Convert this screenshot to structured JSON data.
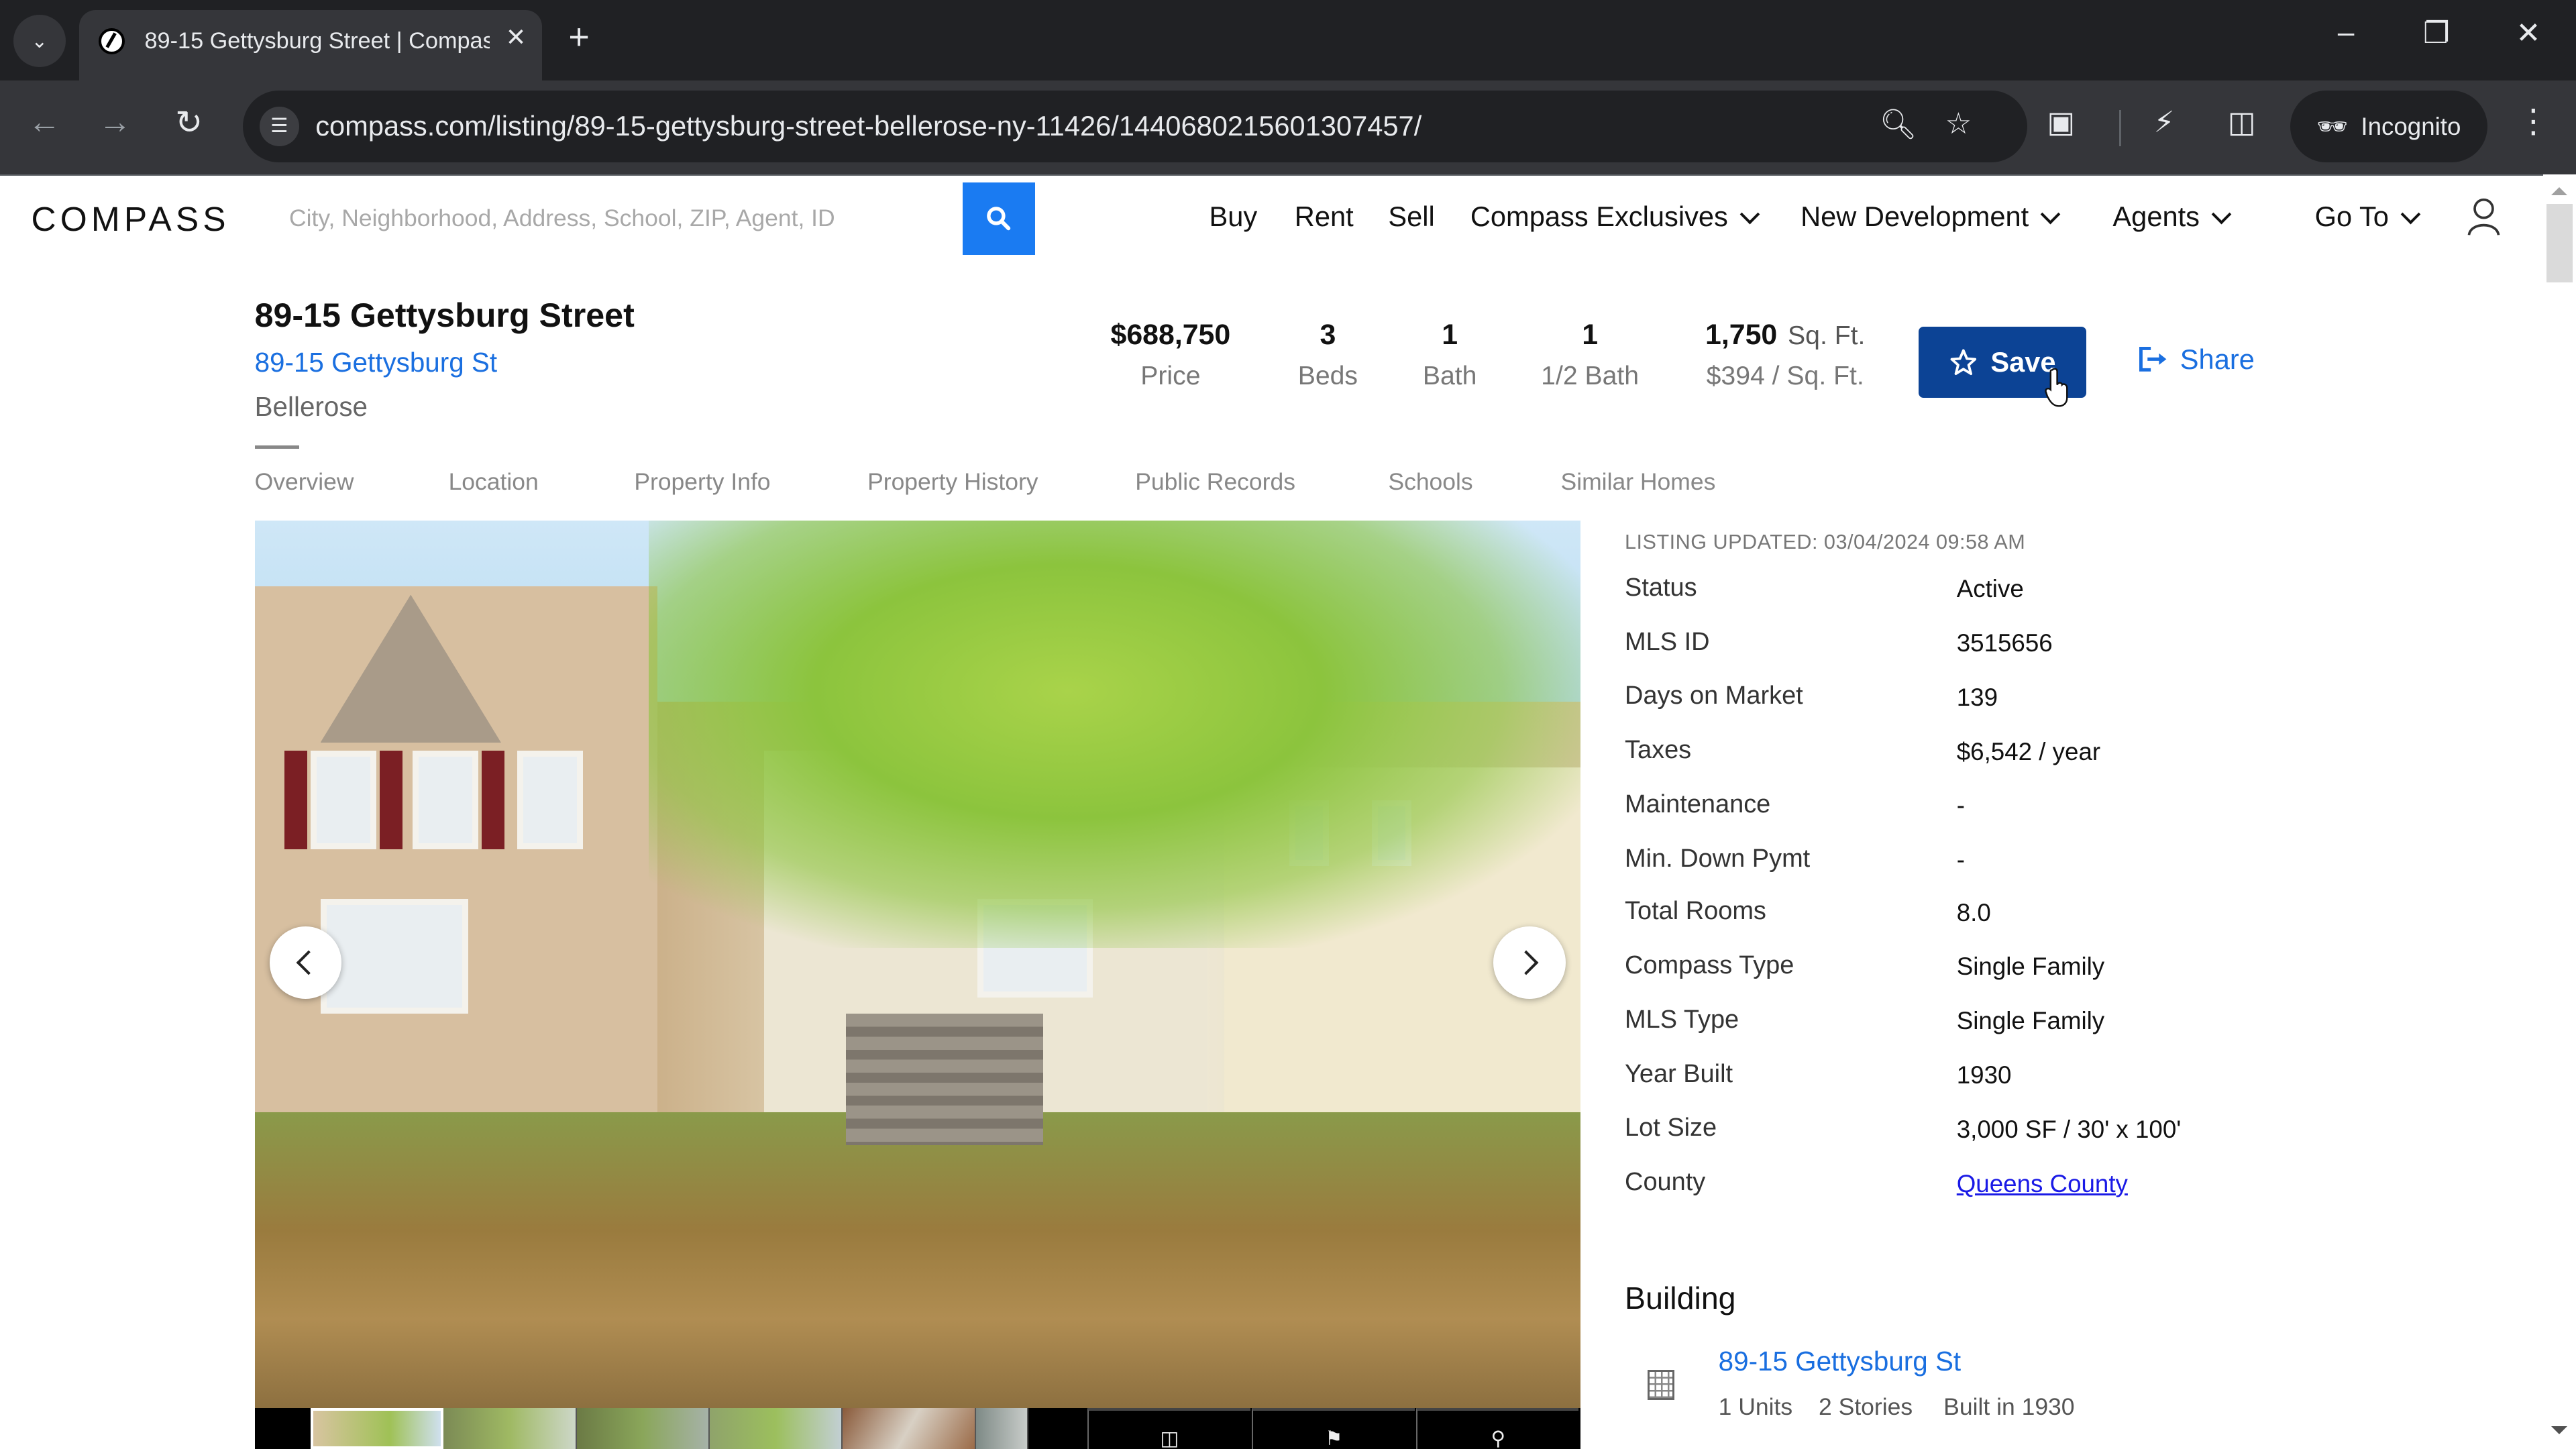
{
  "browser": {
    "tab_title": "89-15 Gettysburg Street | Compass",
    "url": "compass.com/listing/89-15-gettysburg-street-bellerose-ny-11426/1440680215601307457/",
    "profile_label": "Incognito",
    "icons": {
      "tab_search": "chevron-down-icon",
      "favicon": "compass-logo-icon",
      "close_tab": "close-icon",
      "new_tab": "plus-icon",
      "minimize": "minimize-icon",
      "restore": "restore-icon",
      "close_window": "close-icon",
      "back": "back-arrow-icon",
      "forward": "forward-arrow-icon",
      "reload": "reload-icon",
      "site_info": "tune-icon",
      "zoom": "zoom-icon",
      "bookmark": "star-icon",
      "extensions": "puzzle-icon",
      "performance": "energy-saver-icon",
      "side_panel": "side-panel-icon",
      "incognito": "incognito-icon",
      "menu": "more-vert-icon"
    }
  },
  "header": {
    "logo": "COMPASS",
    "search_placeholder": "City, Neighborhood, Address, School, ZIP, Agent, ID",
    "search_value": "",
    "nav": [
      {
        "label": "Buy",
        "dropdown": false
      },
      {
        "label": "Rent",
        "dropdown": false
      },
      {
        "label": "Sell",
        "dropdown": false
      },
      {
        "label": "Compass Exclusives",
        "dropdown": true
      },
      {
        "label": "New Development",
        "dropdown": true
      },
      {
        "label": "Agents",
        "dropdown": true
      },
      {
        "label": "Go To",
        "dropdown": true
      }
    ],
    "brand_color": "#1a7bf2"
  },
  "listing": {
    "title": "89-15 Gettysburg Street",
    "address_link": "89-15 Gettysburg St",
    "neighborhood": "Bellerose",
    "stats": {
      "price": {
        "value": "$688,750",
        "label": "Price"
      },
      "beds": {
        "value": "3",
        "label": "Beds"
      },
      "bath": {
        "value": "1",
        "label": "Bath"
      },
      "half_bath": {
        "value": "1",
        "label": "1/2 Bath"
      },
      "sqft": {
        "value": "1,750",
        "unit": "Sq. Ft.",
        "label": "$394 / Sq. Ft."
      }
    },
    "save_label": "Save",
    "share_label": "Share",
    "save_color": "#0c4395"
  },
  "section_tabs": [
    "Overview",
    "Location",
    "Property Info",
    "Property History",
    "Public Records",
    "Schools",
    "Similar Homes"
  ],
  "photo": {
    "alt": "Front exterior of a two-story house with tree and lawn",
    "thumbnail_count_visible": 6,
    "controls": [
      "floor-plan-icon",
      "map-icon",
      "location-pin-icon"
    ]
  },
  "details": {
    "updated": "LISTING UPDATED: 03/04/2024 09:58 AM",
    "rows": [
      {
        "label": "Status",
        "value": "Active"
      },
      {
        "label": "MLS ID",
        "value": "3515656"
      },
      {
        "label": "Days on Market",
        "value": "139"
      },
      {
        "label": "Taxes",
        "value": "$6,542 / year"
      },
      {
        "label": "Maintenance",
        "value": "-"
      },
      {
        "label": "Min. Down Pymt",
        "value": "-"
      },
      {
        "label": "Total Rooms",
        "value": "8.0"
      },
      {
        "label": "Compass Type",
        "value": "Single Family"
      },
      {
        "label": "MLS Type",
        "value": "Single Family"
      },
      {
        "label": "Year Built",
        "value": "1930"
      },
      {
        "label": "Lot Size",
        "value": "3,000 SF / 30' x 100'"
      },
      {
        "label": "County",
        "value": "Queens County",
        "link": true
      }
    ]
  },
  "building": {
    "heading": "Building",
    "name": "89-15 Gettysburg St",
    "units": "1 Units",
    "stories": "2 Stories",
    "built": "Built in 1930"
  }
}
